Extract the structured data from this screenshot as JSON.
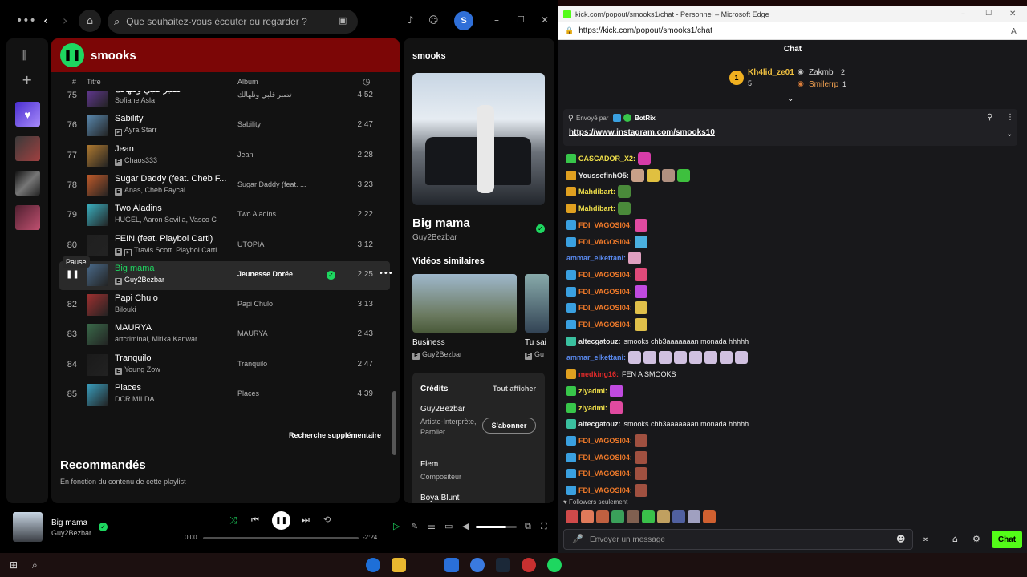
{
  "spotify": {
    "search_placeholder": "Que souhaitez-vous écouter ou regarder ?",
    "avatar_letter": "S",
    "playlist_title": "smooks",
    "columns": {
      "num": "#",
      "title": "Titre",
      "album": "Album"
    },
    "tooltip": "Pause",
    "tracks": [
      {
        "num": "75",
        "title": "تصبر قلبي ونلهالك",
        "artist": "Sofiane Asla",
        "album": "تصبر قلبي ونلهالك",
        "dur": "4:52",
        "e": false,
        "v": false
      },
      {
        "num": "76",
        "title": "Sability",
        "artist": "Ayra Starr",
        "album": "Sability",
        "dur": "2:47",
        "e": false,
        "v": true
      },
      {
        "num": "77",
        "title": "Jean",
        "artist": "Chaos333",
        "album": "Jean",
        "dur": "2:28",
        "e": true,
        "v": false
      },
      {
        "num": "78",
        "title": "Sugar Daddy (feat. Cheb F...",
        "artist": "Anas, Cheb Faycal",
        "album": "Sugar Daddy (feat. ...",
        "dur": "3:23",
        "e": true,
        "v": false
      },
      {
        "num": "79",
        "title": "Two Aladins",
        "artist": "HUGEL, Aaron Sevilla, Vasco C",
        "album": "Two Aladins",
        "dur": "2:22",
        "e": false,
        "v": false
      },
      {
        "num": "80",
        "title": "FE!N (feat. Playboi Carti)",
        "artist": "Travis Scott, Playboi Carti",
        "album": "UTOPIA",
        "dur": "3:12",
        "e": true,
        "v": true
      },
      {
        "num": "",
        "title": "Big mama",
        "artist": "Guy2Bezbar",
        "album": "Jeunesse Dorée",
        "dur": "2:25",
        "e": true,
        "v": false,
        "active": true
      },
      {
        "num": "82",
        "title": "Papi Chulo",
        "artist": "Bilouki",
        "album": "Papi Chulo",
        "dur": "3:13",
        "e": false,
        "v": false
      },
      {
        "num": "83",
        "title": "MAURYA",
        "artist": "artcriminal, Mitika Kanwar",
        "album": "MAURYA",
        "dur": "2:43",
        "e": false,
        "v": false
      },
      {
        "num": "84",
        "title": "Tranquilo",
        "artist": "Young Zow",
        "album": "Tranquilo",
        "dur": "2:47",
        "e": true,
        "v": false
      },
      {
        "num": "85",
        "title": "Places",
        "artist": "DCR MILDA",
        "album": "Places",
        "dur": "4:39",
        "e": false,
        "v": false
      }
    ],
    "more_search": "Recherche supplémentaire",
    "recommended_title": "Recommandés",
    "recommended_sub": "En fonction du contenu de cette playlist",
    "right": {
      "header": "smooks",
      "song": "Big mama",
      "artist": "Guy2Bezbar",
      "videos_title": "Vidéos similaires",
      "video1_title": "Business",
      "video1_artist": "Guy2Bezbar",
      "video2_title": "Tu sai",
      "video2_artist": "Gu",
      "credits_title": "Crédits",
      "show_all": "Tout afficher",
      "credit1_name": "Guy2Bezbar",
      "credit1_role": "Artiste-Interprète, Parolier",
      "subscribe": "S'abonner",
      "credit2_name": "Flem",
      "credit2_role": "Compositeur",
      "credit3_name": "Boya Blunt"
    },
    "player": {
      "title": "Big mama",
      "artist": "Guy2Bezbar",
      "elapsed": "0:00",
      "remaining": "-2:24",
      "progress": 0.0,
      "volume": 0.75
    }
  },
  "edge": {
    "window_title": "kick.com/popout/smooks1/chat - Personnel – Microsoft Edge",
    "url": "https://kick.com/popout/smooks1/chat"
  },
  "chat": {
    "header": "Chat",
    "leaders": [
      {
        "rank": "1",
        "name": "Kh4lid_ze01",
        "count": "5"
      },
      {
        "rank": "",
        "name": "Zakmb",
        "count": "2"
      },
      {
        "rank": "",
        "name": "Smilerrp",
        "count": "1"
      }
    ],
    "pinned_by_label": "Envoyé par",
    "pinned_by": "BotRix",
    "pinned_link": "https://www.instagram.com/smooks10",
    "messages": [
      {
        "user": "CASCADOR_X2:",
        "text": "",
        "color": "#f0e04a",
        "badge": "#38c64a",
        "emotes": [
          "#d63ca8"
        ]
      },
      {
        "user": "YoussefinhO5:",
        "text": "",
        "color": "#e6e6e6",
        "badge": "#e0a020",
        "emotes": [
          "#c9a088",
          "#e0c040",
          "#b09080",
          "#3ec03e"
        ]
      },
      {
        "user": "Mahdibart:",
        "text": "",
        "color": "#f0e04a",
        "badge": "#e0a020",
        "emotes": [
          "#4a8a3a"
        ]
      },
      {
        "user": "Mahdibart:",
        "text": "",
        "color": "#f0e04a",
        "badge": "#e0a020",
        "emotes": [
          "#4a8a3a"
        ]
      },
      {
        "user": "FDI_VAGOSI04:",
        "text": "",
        "color": "#f07a2a",
        "badge": "#3aa0e0",
        "emotes": [
          "#e04aa0"
        ]
      },
      {
        "user": "FDI_VAGOSI04:",
        "text": "",
        "color": "#f07a2a",
        "badge": "#3aa0e0",
        "emotes": [
          "#4ab0e0"
        ]
      },
      {
        "user": "ammar_elkettani:",
        "text": "",
        "color": "#5a8af0",
        "badge": "",
        "emotes": [
          "#e0a0c0"
        ]
      },
      {
        "user": "FDI_VAGOSI04:",
        "text": "",
        "color": "#f07a2a",
        "badge": "#3aa0e0",
        "emotes": [
          "#e04a7a"
        ]
      },
      {
        "user": "FDI_VAGOSI04:",
        "text": "",
        "color": "#f07a2a",
        "badge": "#3aa0e0",
        "emotes": [
          "#c04ae0"
        ]
      },
      {
        "user": "FDI_VAGOSI04:",
        "text": "",
        "color": "#f07a2a",
        "badge": "#3aa0e0",
        "emotes": [
          "#e0c04a"
        ]
      },
      {
        "user": "FDI_VAGOSI04:",
        "text": "",
        "color": "#f07a2a",
        "badge": "#3aa0e0",
        "emotes": [
          "#e0c04a"
        ]
      },
      {
        "user": "altecgatouz:",
        "text": "smooks chb3aaaaaaan monada hhhhh",
        "color": "#e6e6e6",
        "badge": "#3ac0a0",
        "emotes": []
      },
      {
        "user": "ammar_elkettani:",
        "text": "",
        "color": "#5a8af0",
        "badge": "",
        "emotes": [
          "#d0c0e0",
          "#d0c0e0",
          "#d0c0e0",
          "#d0c0e0",
          "#d0c0e0",
          "#d0c0e0",
          "#d0c0e0",
          "#d0c0e0"
        ]
      },
      {
        "user": "medking16:",
        "text": "FEN A SMOOKS",
        "color": "#e02a2a",
        "badge": "#e0a020",
        "emotes": []
      },
      {
        "user": "ziyadml:",
        "text": "",
        "color": "#f0e04a",
        "badge": "#38c64a",
        "emotes": [
          "#c04ae0"
        ]
      },
      {
        "user": "ziyadml:",
        "text": "",
        "color": "#f0e04a",
        "badge": "#38c64a",
        "emotes": [
          "#e04aa0"
        ]
      },
      {
        "user": "altecgatouz:",
        "text": "smooks chb3aaaaaaan monada hhhhh",
        "color": "#e6e6e6",
        "badge": "#3ac0a0",
        "emotes": []
      },
      {
        "user": "FDI_VAGOSI04:",
        "text": "",
        "color": "#f07a2a",
        "badge": "#3aa0e0",
        "emotes": [
          "#a05040"
        ]
      },
      {
        "user": "FDI_VAGOSI04:",
        "text": "",
        "color": "#f07a2a",
        "badge": "#3aa0e0",
        "emotes": [
          "#a05040"
        ]
      },
      {
        "user": "FDI_VAGOSI04:",
        "text": "",
        "color": "#f07a2a",
        "badge": "#3aa0e0",
        "emotes": [
          "#a05040"
        ]
      },
      {
        "user": "FDI_VAGOSI04:",
        "text": "",
        "color": "#f07a2a",
        "badge": "#3aa0e0",
        "emotes": [
          "#a05040"
        ]
      }
    ],
    "followers_only": "Followers seulement",
    "emote_bar": [
      "#d04a4a",
      "#e07a5a",
      "#c06040",
      "#3aa05a",
      "#806050",
      "#3ac04a",
      "#c0a060",
      "#5060a0",
      "#a0a0c0",
      "#d06030"
    ],
    "input_placeholder": "Envoyer un message",
    "send_button": "Chat",
    "brand_color": "#53fc18"
  },
  "colors": {
    "spotify_green": "#1ed760",
    "playlist_header": "#7c0606"
  }
}
